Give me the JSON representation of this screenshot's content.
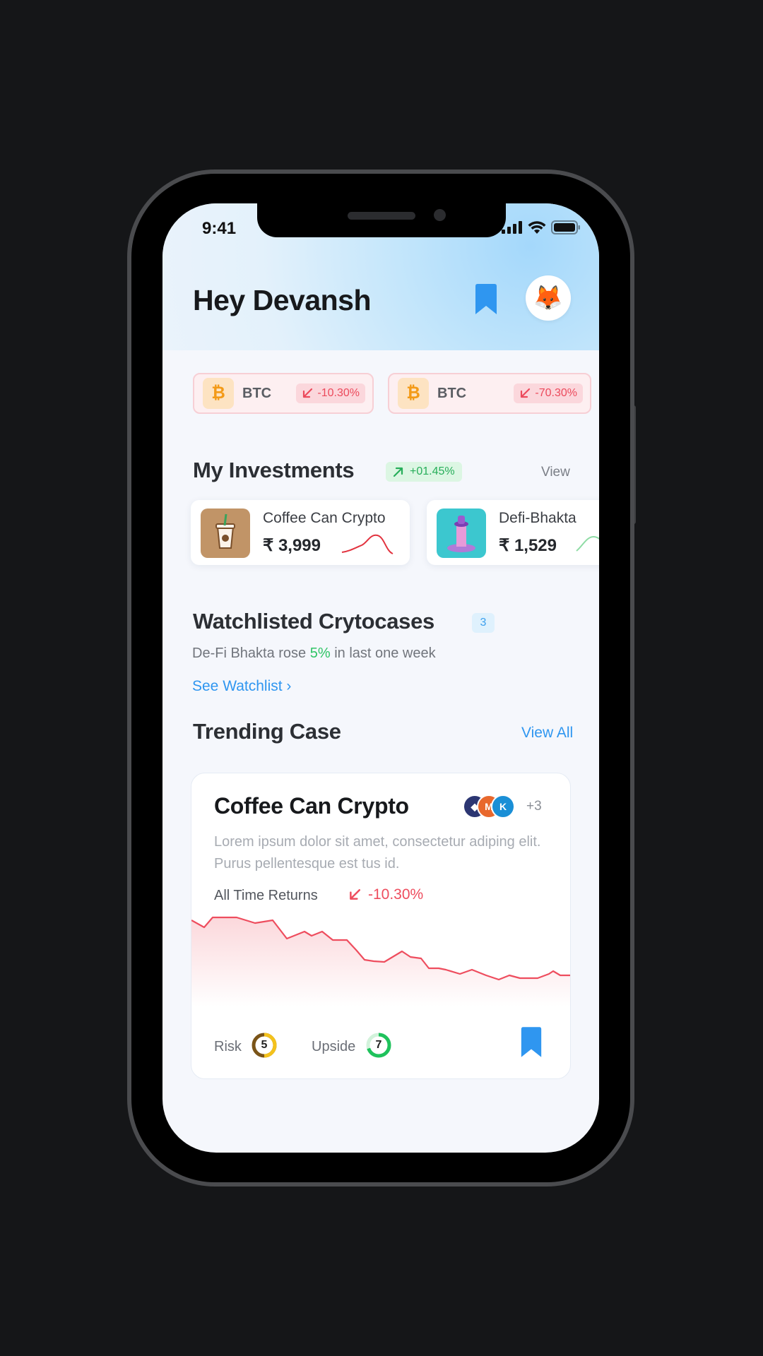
{
  "status": {
    "time": "9:41"
  },
  "header": {
    "greeting": "Hey Devansh",
    "avatar_emoji": "🦊"
  },
  "tickers": [
    {
      "symbol": "BTC",
      "coin_glyph": "₿",
      "change": "-10.30%"
    },
    {
      "symbol": "BTC",
      "coin_glyph": "₿",
      "change": "-70.30%"
    }
  ],
  "investments": {
    "title": "My Investments",
    "gain": "+01.45%",
    "view_label": "View",
    "items": [
      {
        "name": "Coffee Can Crypto",
        "price": "₹ 3,999",
        "trend": "down"
      },
      {
        "name": "Defi-Bhakta",
        "price": "₹ 1,529",
        "trend": "up"
      }
    ]
  },
  "watchlist": {
    "title": "Watchlisted Crytocases",
    "count": "3",
    "sub_prefix": "De-Fi Bhakta rose ",
    "sub_highlight": "5%",
    "sub_suffix": " in last one week",
    "link": "See Watchlist ›"
  },
  "trending": {
    "title": "Trending Case",
    "view_all": "View All",
    "card": {
      "title": "Coffee Can Crypto",
      "more_count": "+3",
      "description": "Lorem ipsum dolor sit amet, consectetur adiping elit. Purus pellentesque est tus id.",
      "returns_label": "All Time Returns",
      "returns_value": "-10.30%",
      "risk_label": "Risk",
      "risk_value": "5",
      "upside_label": "Upside",
      "upside_value": "7"
    }
  },
  "colors": {
    "accent_blue": "#2f96f0",
    "negative": "#ee4d5e",
    "positive": "#2fc465"
  }
}
